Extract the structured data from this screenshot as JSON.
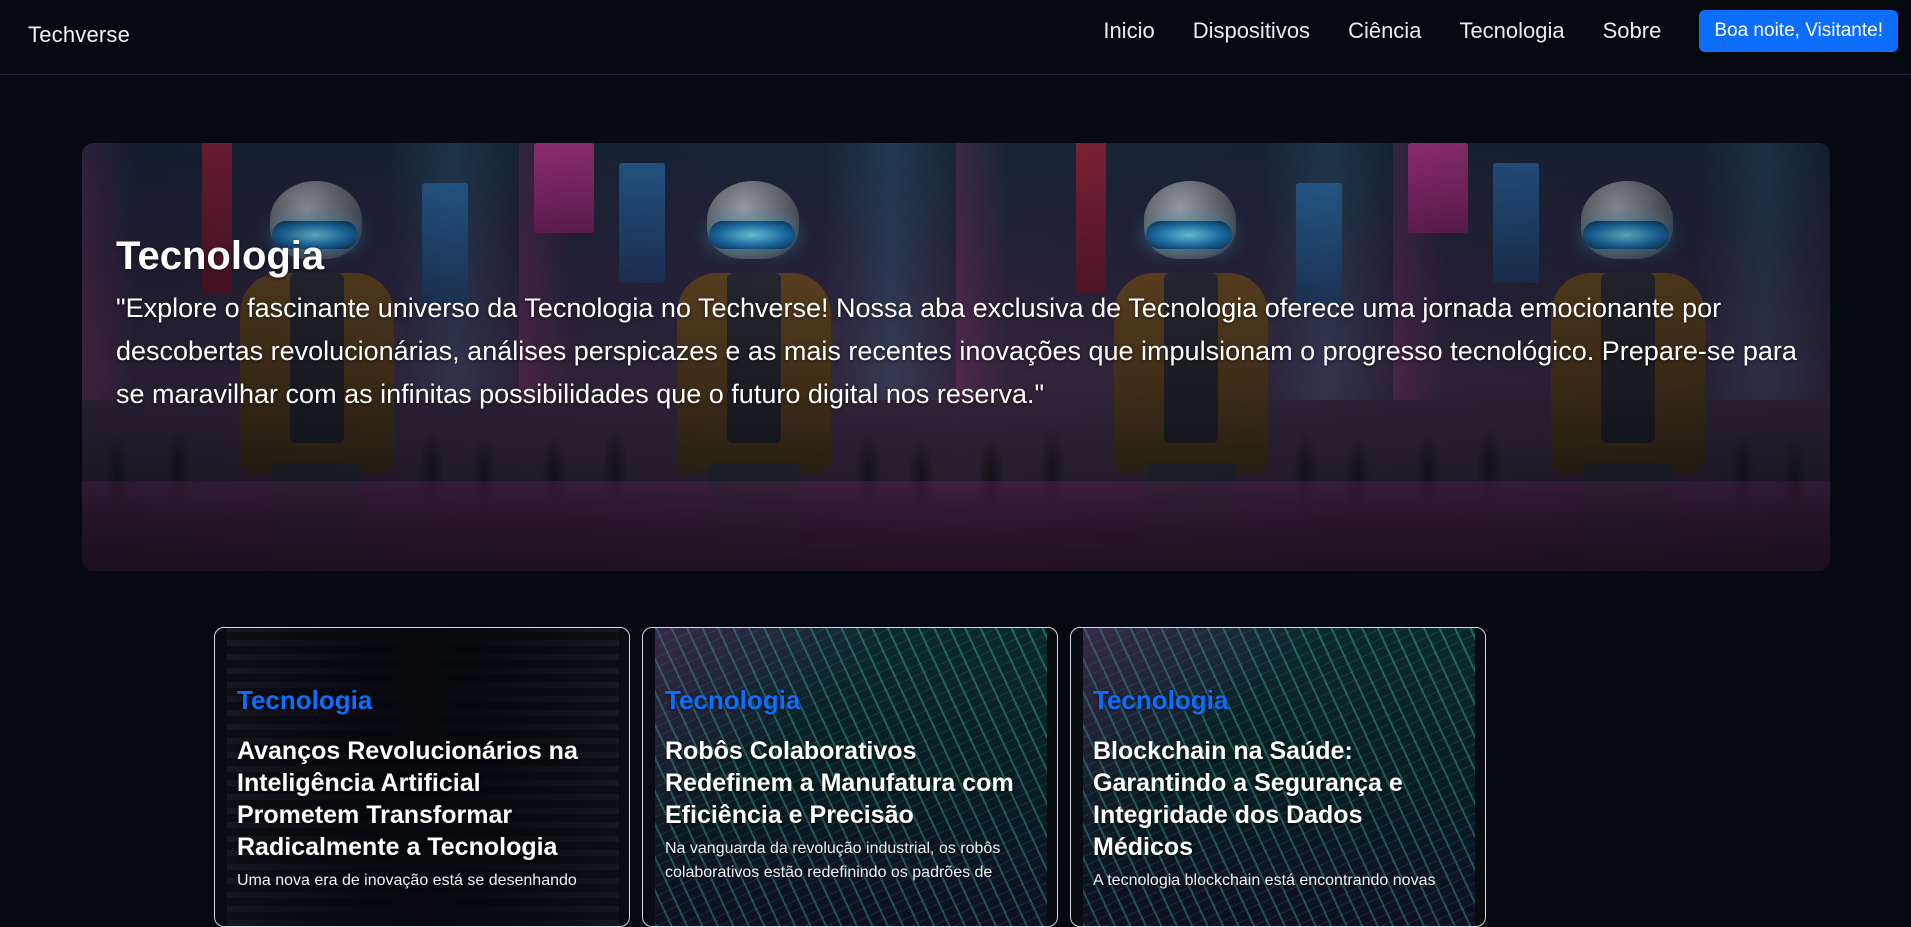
{
  "navbar": {
    "brand": "Techverse",
    "links": [
      "Inicio",
      "Dispositivos",
      "Ciência",
      "Tecnologia",
      "Sobre"
    ],
    "greeting_button": "Boa noite, Visitante!"
  },
  "hero": {
    "title": "Tecnologia",
    "description": "\"Explore o fascinante universo da Tecnologia no Techverse! Nossa aba exclusiva de Tecnologia oferece uma jornada emocionante por descobertas revolucionárias, análises perspicazes e as mais recentes inovações que impulsionam o progresso tecnológico. Prepare-se para se maravilhar com as infinitas possibilidades que o futuro digital nos reserva.\""
  },
  "cards": [
    {
      "category": "Tecnologia",
      "title": "Avanços Revolucionários na Inteligência Artificial Prometem Transformar Radicalmente a Tecnologia",
      "excerpt": "Uma nova era de inovação está se desenhando",
      "image": "robot-image"
    },
    {
      "category": "Tecnologia",
      "title": "Robôs Colaborativos Redefinem a Manufatura com Eficiência e Precisão",
      "excerpt": "Na vanguarda da revolução industrial, os robôs colaborativos estão redefinindo os padrões de",
      "image": "circuit-image"
    },
    {
      "category": "Tecnologia",
      "title": "Blockchain na Saúde: Garantindo a Segurança e Integridade dos Dados Médicos",
      "excerpt": "A tecnologia blockchain está encontrando novas",
      "image": "circuit-image"
    }
  ],
  "colors": {
    "background": "#060913",
    "accent": "#0d6efd",
    "text": "#ffffff"
  }
}
